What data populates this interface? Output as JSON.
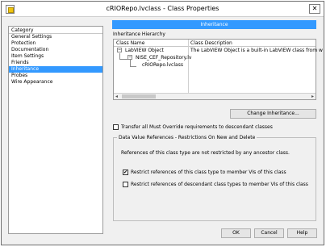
{
  "window": {
    "title": "cRIORepo.lvclass - Class Properties",
    "close_glyph": "✕"
  },
  "sidebar": {
    "header": "Category",
    "items": [
      "General Settings",
      "Protection",
      "Documentation",
      "Item Settings",
      "Friends",
      "Inheritance",
      "Probes",
      "Wire Appearance"
    ],
    "selected_index": 5
  },
  "main": {
    "section_title": "Inheritance",
    "hierarchy_label": "Inheritance Hierarchy",
    "table": {
      "columns": [
        "Class Name",
        "Class Description"
      ],
      "rows": [
        {
          "name": "LabVIEW Object",
          "description": "The LabVIEW Object is a built-in LabVIEW class from w",
          "toggle": "−"
        },
        {
          "name": "NISE_CEF_Repository.lv",
          "description": "",
          "toggle": "−"
        },
        {
          "name": "cRIORepo.lvclass",
          "description": ""
        }
      ]
    },
    "change_inheritance_label": "Change Inheritance...",
    "transfer_checkbox": {
      "label": "Transfer all Must Override requirements to descendant classes",
      "checked": false
    },
    "dvr_group": {
      "title": "Data Value References - Restrictions On New and Delete",
      "note": "References of this class type are not restricted by any ancestor class.",
      "options": [
        {
          "label": "Restrict references of this class type to member VIs of this class",
          "checked": true
        },
        {
          "label": "Restrict references of descendant class types to member VIs of this class",
          "checked": false
        }
      ]
    }
  },
  "footer": {
    "ok_label": "OK",
    "cancel_label": "Cancel",
    "help_label": "Help"
  },
  "icons": {
    "check_glyph": "✔",
    "arrow_left": "◂",
    "arrow_right": "▸"
  }
}
